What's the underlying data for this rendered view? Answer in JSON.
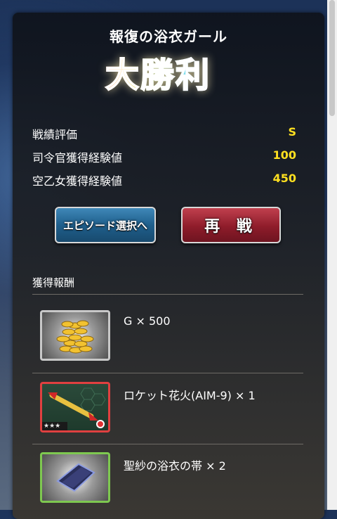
{
  "result": {
    "stage_title": "報復の浴衣ガール",
    "victory_text": "大勝利"
  },
  "stats": [
    {
      "label": "戦績評価",
      "value": "S"
    },
    {
      "label": "司令官獲得経験値",
      "value": "100"
    },
    {
      "label": "空乙女獲得経験値",
      "value": "450"
    }
  ],
  "buttons": {
    "episode_select": "エピソード選択へ",
    "retry": "再 戦"
  },
  "rewards": {
    "section_title": "獲得報酬",
    "items": [
      {
        "name": "G × 500",
        "icon": "gold-coins-icon"
      },
      {
        "name": "ロケット花火(AIM-9) × 1",
        "icon": "rocket-missile-icon",
        "stars": "★★★"
      },
      {
        "name": "聖紗の浴衣の帯 × 2",
        "icon": "sash-icon"
      }
    ]
  },
  "colors": {
    "stat_value": "#ffe020",
    "episode_button": "#1f5f8c",
    "retry_button": "#8e1c2a",
    "rare_border_red": "#e04040",
    "rare_border_green": "#7ec850"
  }
}
